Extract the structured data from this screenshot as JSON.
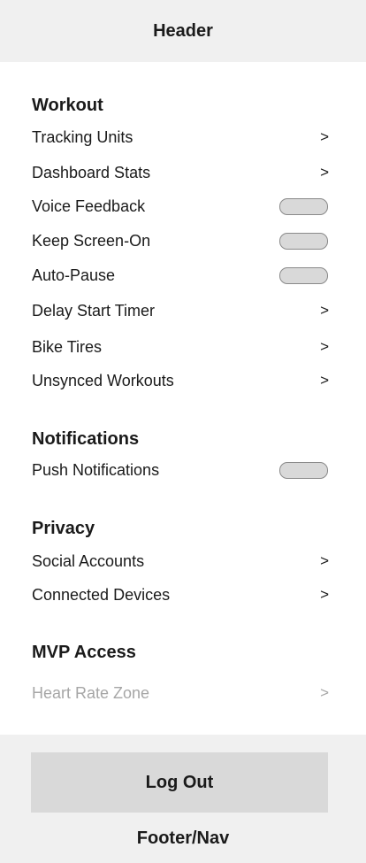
{
  "header": {
    "title": "Header"
  },
  "sections": {
    "workout": {
      "title": "Workout",
      "items": [
        {
          "label": "Tracking Units",
          "control": ">"
        },
        {
          "label": "Dashboard Stats",
          "control": ">"
        },
        {
          "label": "Voice Feedback",
          "control": "toggle"
        },
        {
          "label": "Keep Screen-On",
          "control": "toggle"
        },
        {
          "label": "Auto-Pause",
          "control": "toggle"
        },
        {
          "label": "Delay Start Timer",
          "control": ">"
        },
        {
          "label": "Bike Tires",
          "control": ">"
        },
        {
          "label": "Unsynced Workouts",
          "control": ">"
        }
      ]
    },
    "notifications": {
      "title": "Notifications",
      "items": [
        {
          "label": "Push Notifications",
          "control": "toggle"
        }
      ]
    },
    "privacy": {
      "title": "Privacy",
      "items": [
        {
          "label": "Social Accounts",
          "control": ">"
        },
        {
          "label": "Connected Devices",
          "control": ">"
        }
      ]
    },
    "mvp": {
      "title": "MVP Access",
      "items": [
        {
          "label": "Heart Rate Zone",
          "control": ">",
          "disabled": true
        }
      ]
    }
  },
  "chevron_glyph": ">",
  "footer": {
    "logout_label": "Log Out",
    "nav_label": "Footer/Nav"
  },
  "colors": {
    "bar_background": "#f0f0f0",
    "button_background": "#d9d9d9",
    "toggle_fill": "#d9d9d9",
    "disabled_text": "#a6a6a6"
  }
}
